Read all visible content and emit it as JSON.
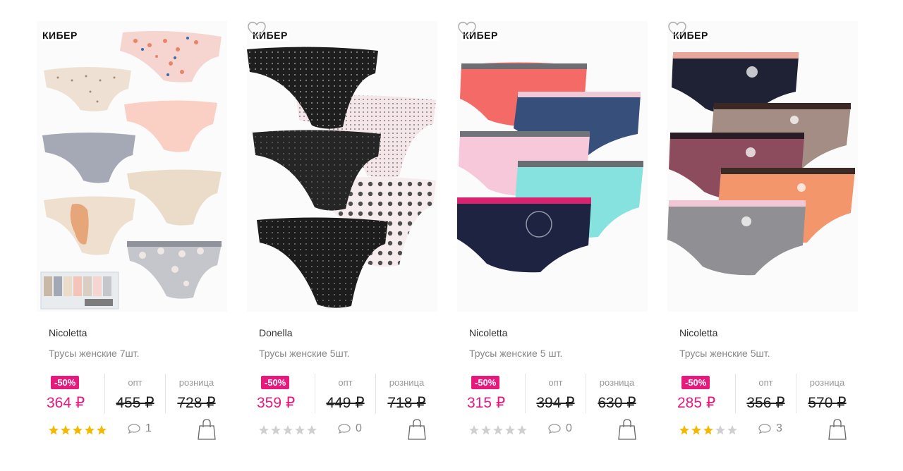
{
  "products": [
    {
      "tag": "КИБЕР",
      "brand": "Nicoletta",
      "title": "Трусы женские 7шт.",
      "discount": "-50%",
      "price": "364 ₽",
      "opt_label": "опт",
      "opt_price": "455 ₽",
      "retail_label": "розница",
      "retail_price": "728 ₽",
      "rating": 5,
      "comments": "1",
      "image": "seven-pack-pastel-briefs"
    },
    {
      "tag": "КИБЕР",
      "brand": "Donella",
      "title": "Трусы женские 5шт.",
      "discount": "-50%",
      "price": "359 ₽",
      "opt_label": "опт",
      "opt_price": "449 ₽",
      "retail_label": "розница",
      "retail_price": "718 ₽",
      "rating": 0,
      "comments": "0",
      "image": "five-pack-black-white-polka-briefs"
    },
    {
      "tag": "КИБЕР",
      "brand": "Nicoletta",
      "title": "Трусы женские 5 шт.",
      "discount": "-50%",
      "price": "315 ₽",
      "opt_label": "опт",
      "opt_price": "394 ₽",
      "retail_label": "розница",
      "retail_price": "630 ₽",
      "rating": 0,
      "comments": "0",
      "image": "five-pack-colorful-hipsters"
    },
    {
      "tag": "КИБЕР",
      "brand": "Nicoletta",
      "title": "Трусы женские 5шт.",
      "discount": "-50%",
      "price": "285 ₽",
      "opt_label": "опт",
      "opt_price": "356 ₽",
      "retail_label": "розница",
      "retail_price": "570 ₽",
      "rating": 3,
      "comments": "3",
      "image": "five-pack-cat-print-hipsters"
    }
  ],
  "colors": {
    "accent": "#e6197d",
    "star_on": "#f5b800",
    "star_off": "#d0d0d0"
  },
  "icons": {
    "favorite": "heart-outline-icon",
    "comments": "speech-bubble-icon",
    "cart": "shopping-bag-icon",
    "rating": "star-icon"
  }
}
